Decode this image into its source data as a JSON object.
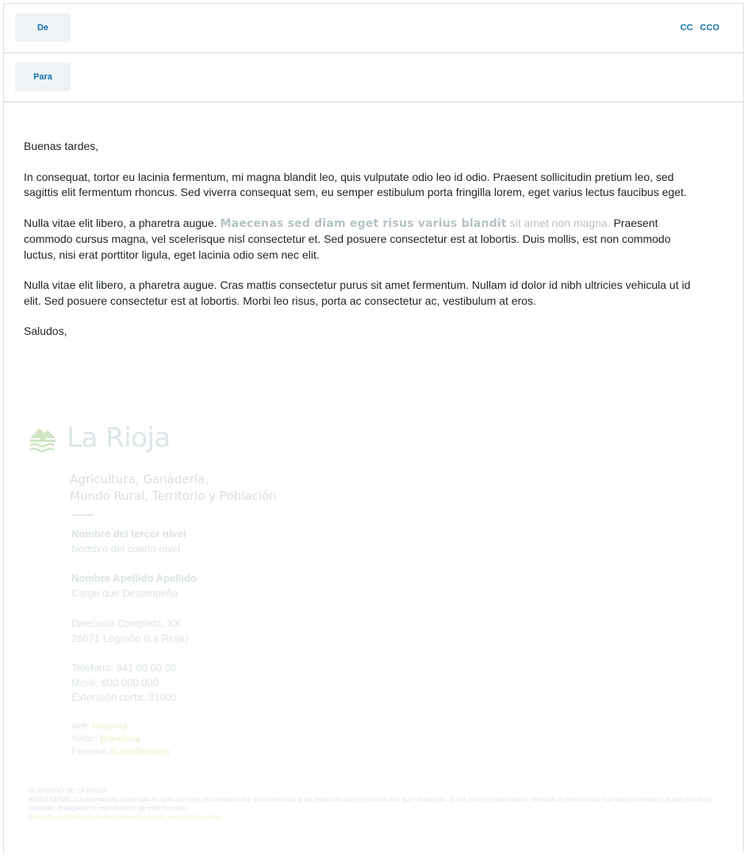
{
  "header": {
    "from_label": "De",
    "to_label": "Para",
    "cc_label": "CC",
    "bcc_label": "CCO"
  },
  "message": {
    "greeting": "Buenas tardes,",
    "para1": "In consequat, tortor eu lacinia fermentum, mi magna blandit leo, quis vulputate odio leo id odio. Praesent sollicitudin pretium leo, sed sagittis elit fermentum rhoncus. Sed viverra consequat sem, eu semper estibulum porta fringilla lorem, eget varius lectus faucibus eget.",
    "para2_start": "Nulla vitae elit libero, a pharetra augue. ",
    "para2_highlight": "Maecenas sed diam eget risus varius blandit",
    "para2_faded": " sit amet non magna.",
    "para2_end": " Praesent commodo cursus magna, vel scelerisque nisl consectetur et. Sed posuere consectetur est at lobortis. Duis mollis, est non commodo luctus, nisi erat porttitor ligula, eget lacinia odio sem nec elit.",
    "para3": "Nulla vitae elit libero, a pharetra augue. Cras mattis consectetur purus sit amet fermentum. Nullam id dolor id nibh ultricies vehicula ut id elit. Sed posuere consectetur est at lobortis. Morbi leo risus, porta ac consectetur ac, vestibulum at eros.",
    "closing": "Saludos,"
  },
  "signature": {
    "logo_text": "La Rioja",
    "dept_line1": "Agricultura, Ganadería,",
    "dept_line2": "Mundo Rural, Territorio y Población",
    "level3": "Nombre del tercer nivel",
    "level4": "Nombre del cuarto nivel",
    "name": "Nombre Apellido Apellido",
    "role": "Cargo que Desempeña",
    "address1": "Dirección Completa, XX",
    "address2": "26071 Logroño (La Rioja)",
    "phone": "Teléfono: 941 00 00 00",
    "mobile": "Móvil: 600 000 000",
    "ext": "Extensión corta: 31000",
    "web_label": "Web: ",
    "web_link": "larioja.org",
    "twitter_label": "Twitter: ",
    "twitter_link": "@Iariojaorg",
    "facebook_label": "Facebook: ",
    "facebook_link": "fb.com/lariojaorg"
  },
  "legal": {
    "gov": "GOBIERNO DE LA RIOJA",
    "notice": "AVISO LEGAL: La información contenida en este mensaje es confidencial y está destinada a ser leída sólo por la persona a la que va dirigida. Si Ud. no es el destinatario señalado le informamos que está prohibida, y puede ser ilegal, cualquier divulgación o reproducción de este mensaje.",
    "print": "Antes de imprimir este e-mail piense bien si es necesario hacerlo."
  },
  "colors": {
    "accent": "#1473a9",
    "logo_green": "#cfe5c3"
  }
}
